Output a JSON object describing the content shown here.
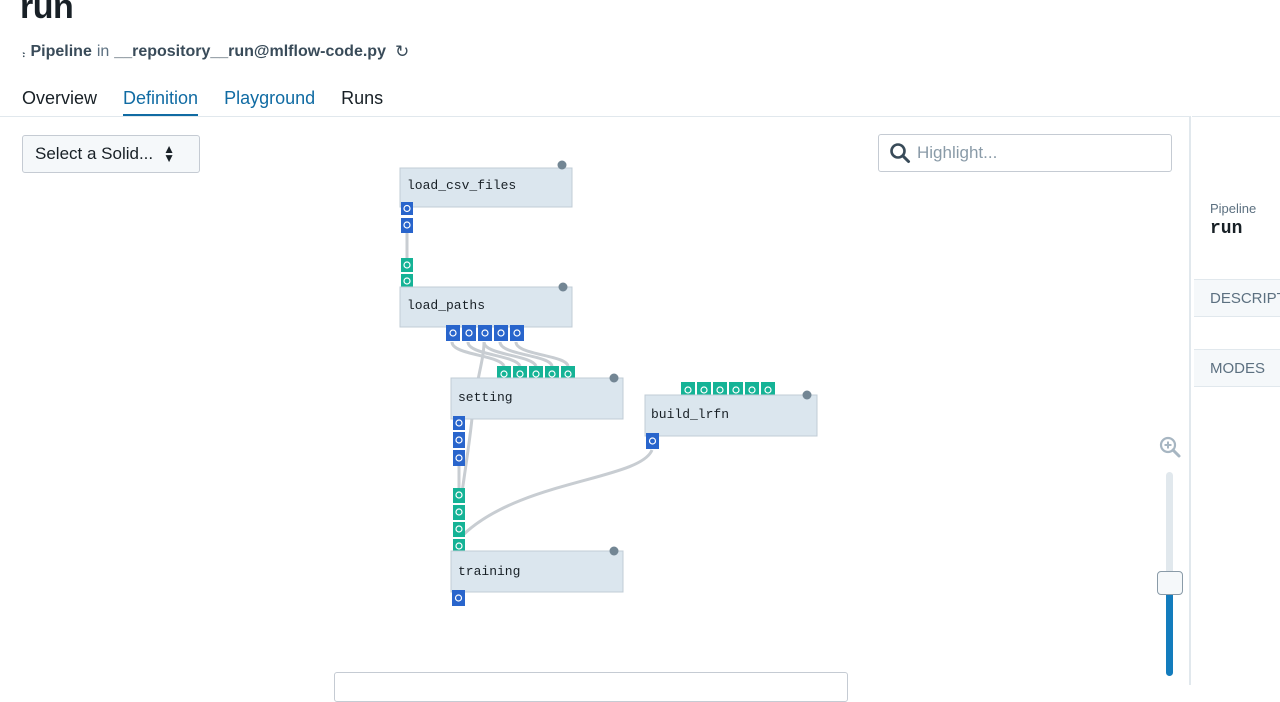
{
  "header": {
    "title": "run",
    "type_label": "Pipeline",
    "in_text": "in",
    "repository": "__repository__run@mlflow-code.py"
  },
  "tabs": [
    {
      "label": "Overview"
    },
    {
      "label": "Definition"
    },
    {
      "label": "Playground"
    },
    {
      "label": "Runs"
    }
  ],
  "toolbar": {
    "select_label": "Select a Solid...",
    "search_placeholder": "Highlight..."
  },
  "graph": {
    "solids": [
      {
        "name": "load_csv_files"
      },
      {
        "name": "load_paths"
      },
      {
        "name": "setting"
      },
      {
        "name": "build_lrfn"
      },
      {
        "name": "training"
      }
    ]
  },
  "side_panel": {
    "label": "Pipeline",
    "name": "run",
    "sections": [
      "DESCRIPTION",
      "MODES"
    ]
  },
  "colors": {
    "accent": "#106ba3",
    "solid_bg": "#dbe6ee",
    "input_port": "#15b396",
    "output_port": "#2965cc",
    "edge": "#c8cdd2"
  },
  "icons": {
    "pipeline": "tree-icon",
    "reload": "reload-icon",
    "search": "search-icon",
    "zoom_in": "zoom-in-icon"
  }
}
